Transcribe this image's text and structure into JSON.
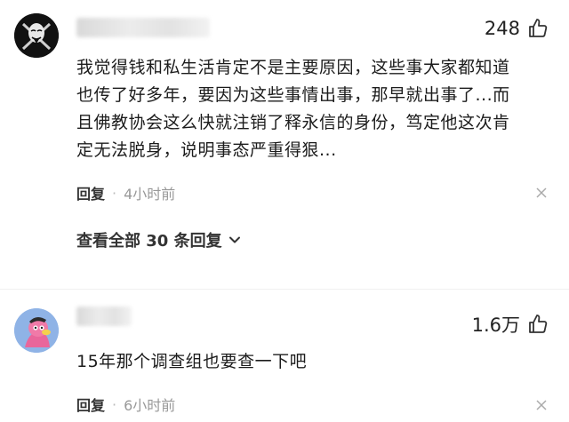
{
  "comments": [
    {
      "likes": "248",
      "text_lines": [
        "我觉得钱和私生活肯定不是主要原因，这些事大家都知道",
        "也传了好多年，要因为这些事情出事，那早就出事了...而",
        "且佛教协会这么快就注销了释永信的身份，笃定他这次肯",
        "定无法脱身，说明事态严重得狠..."
      ],
      "reply_label": "回复",
      "separator": "·",
      "time": "4小时前",
      "view_replies": "查看全部 30 条回复"
    },
    {
      "likes": "1.6万",
      "text_lines": [
        "15年那个调查组也要查一下吧"
      ],
      "reply_label": "回复",
      "separator": "·",
      "time": "6小时前"
    }
  ],
  "icons": {
    "like": "thumbs-up-icon",
    "close": "close-icon",
    "chevron": "chevron-down-icon",
    "avatar1": "mask-avatar",
    "avatar2": "cartoon-avatar"
  },
  "colors": {
    "text": "#1c1c1c",
    "meta": "#999999",
    "avatar2_bg": "#8fb3e6"
  }
}
